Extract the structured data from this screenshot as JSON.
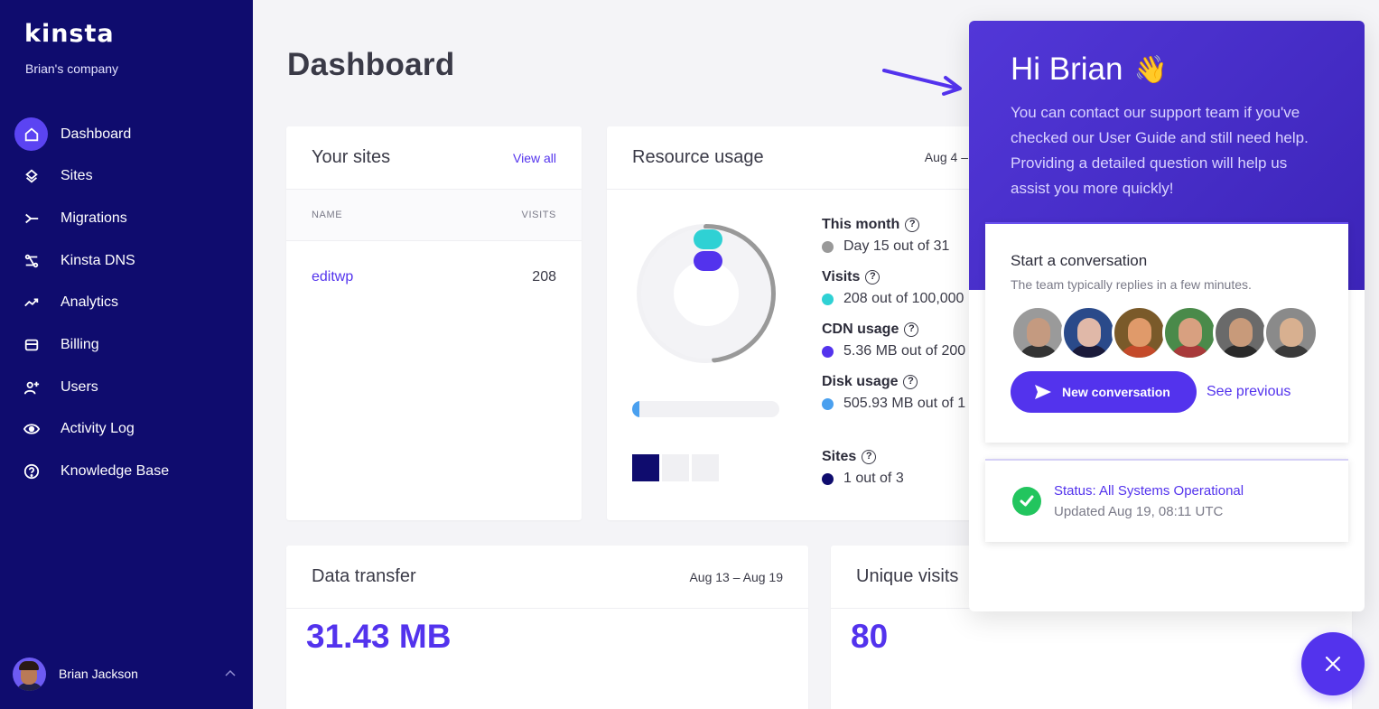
{
  "colors": {
    "sidebar": "#0f0c6e",
    "accent": "#5333ed",
    "cyan": "#2fd1d4",
    "blue": "#4aa0ef",
    "gray": "#999999",
    "navy": "#0f0c6e",
    "success": "#22c55e"
  },
  "sidebar": {
    "logo": "kinsta",
    "company": "Brian's company",
    "items": [
      {
        "label": "Dashboard",
        "icon": "home-icon"
      },
      {
        "label": "Sites",
        "icon": "layers-icon"
      },
      {
        "label": "Migrations",
        "icon": "migrate-icon"
      },
      {
        "label": "Kinsta DNS",
        "icon": "dns-icon"
      },
      {
        "label": "Analytics",
        "icon": "trend-icon"
      },
      {
        "label": "Billing",
        "icon": "card-icon"
      },
      {
        "label": "Users",
        "icon": "user-plus-icon"
      },
      {
        "label": "Activity Log",
        "icon": "eye-icon"
      },
      {
        "label": "Knowledge Base",
        "icon": "help-icon"
      }
    ],
    "user": {
      "name": "Brian Jackson"
    }
  },
  "main": {
    "title": "Dashboard",
    "sites": {
      "title": "Your sites",
      "view_all": "View all",
      "col_name": "NAME",
      "col_visits": "VISITS",
      "rows": [
        {
          "name": "editwp",
          "visits": "208"
        }
      ]
    },
    "resource": {
      "title": "Resource usage",
      "date": "Aug 4 –",
      "this_month_label": "This month",
      "this_month_value": "Day 15 out of 31",
      "this_month_progress": 0.48,
      "visits_label": "Visits",
      "visits_value": "208 out of 100,000",
      "visits_progress": 0.002,
      "cdn_label": "CDN usage",
      "cdn_value": "5.36 MB out of 200",
      "cdn_progress": 0.003,
      "disk_label": "Disk usage",
      "disk_value": "505.93 MB out of 1",
      "disk_progress": 0.05,
      "sites_label": "Sites",
      "sites_value": "1 out of 3",
      "sites_used": 1,
      "sites_total": 3
    },
    "data_transfer": {
      "title": "Data transfer",
      "date": "Aug 13 – Aug 19",
      "value": "31.43 MB"
    },
    "unique_visits": {
      "title": "Unique visits",
      "value": "80"
    }
  },
  "widget": {
    "greeting": "Hi Brian",
    "greeting_emoji": "👋",
    "intro": "You can contact our support team if you've checked our User Guide and still need help. Providing a detailed question will help us assist you more quickly!",
    "conversation": {
      "title": "Start a conversation",
      "subtitle": "The team typically replies in a few minutes.",
      "new_button": "New conversation",
      "see_previous": "See previous"
    },
    "status": {
      "title": "Status: All Systems Operational",
      "updated": "Updated Aug 19, 08:11 UTC"
    }
  }
}
